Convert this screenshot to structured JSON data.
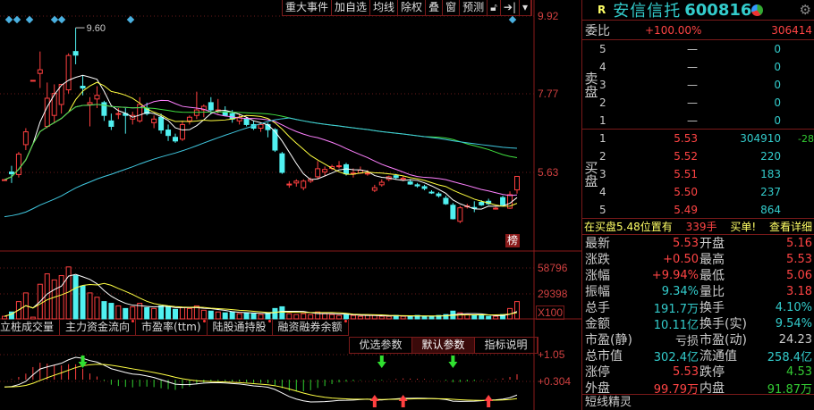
{
  "toolbar": {
    "items": [
      "重大事件",
      "加自选",
      "均线",
      "除权",
      "叠",
      "窗",
      "预测"
    ],
    "lock_icon": "lock-icon",
    "jump_icon": "jump-end-icon",
    "menu_icon": "dropdown-icon"
  },
  "axis": {
    "price_top": "9.92",
    "price_mid": "7.77",
    "price_low": "5.63",
    "vol_top": "58796",
    "vol_mid": "29398",
    "vol_unit": "X100",
    "ind_top": "+1.05",
    "ind_mid": "+0.304"
  },
  "annotations": {
    "high_label": "9.60",
    "bang_label": "榜"
  },
  "tabs": [
    {
      "label": "立桩成交量"
    },
    {
      "label": "主力资金流向"
    },
    {
      "label": "市盈率(ttm)"
    },
    {
      "label": "陆股通持股"
    },
    {
      "label": "融资融券余额"
    }
  ],
  "subtabs": [
    {
      "label": "优选参数"
    },
    {
      "label": "默认参数"
    },
    {
      "label": "指标说明"
    }
  ],
  "chart_data": {
    "type": "candlestick",
    "price_range": [
      3.5,
      9.92
    ],
    "candles": [
      [
        5.44,
        5.44,
        5.44,
        5.44
      ],
      [
        5.65,
        5.82,
        5.35,
        5.6
      ],
      [
        5.58,
        6.2,
        5.5,
        6.14
      ],
      [
        6.4,
        6.85,
        6.25,
        6.75
      ],
      [
        8.16,
        8.16,
        8.16,
        8.16
      ],
      [
        8.35,
        8.95,
        7.95,
        8.45
      ],
      [
        6.9,
        8.1,
        6.85,
        7.67
      ],
      [
        7.2,
        8.05,
        7.0,
        7.8
      ],
      [
        7.5,
        8.05,
        7.25,
        8.05
      ],
      [
        7.9,
        8.9,
        7.8,
        8.84
      ],
      [
        8.95,
        9.6,
        8.6,
        8.85
      ],
      [
        8.0,
        8.3,
        7.75,
        7.95
      ],
      [
        7.5,
        7.7,
        6.9,
        7.55
      ],
      [
        7.65,
        8.0,
        7.4,
        7.75
      ],
      [
        7.55,
        7.6,
        7.05,
        7.2
      ],
      [
        7.05,
        7.25,
        6.8,
        6.9
      ],
      [
        7.25,
        7.4,
        7.1,
        7.25
      ],
      [
        7.25,
        7.4,
        6.7,
        7.2
      ],
      [
        7.1,
        7.3,
        6.95,
        7.2
      ],
      [
        7.05,
        7.7,
        7.0,
        7.5
      ],
      [
        7.4,
        7.55,
        7.2,
        7.25
      ],
      [
        7.0,
        7.2,
        6.85,
        7.1
      ],
      [
        7.15,
        7.25,
        6.7,
        6.8
      ],
      [
        6.8,
        6.95,
        6.5,
        6.65
      ],
      [
        6.6,
        6.7,
        6.45,
        6.5
      ],
      [
        6.55,
        7.05,
        6.5,
        6.95
      ],
      [
        7.05,
        7.2,
        6.95,
        7.15
      ],
      [
        7.2,
        7.85,
        7.1,
        7.35
      ],
      [
        7.35,
        7.5,
        7.15,
        7.45
      ],
      [
        7.55,
        7.7,
        7.25,
        7.35
      ],
      [
        7.35,
        7.65,
        7.25,
        7.35
      ],
      [
        7.3,
        7.45,
        7.2,
        7.2
      ],
      [
        7.25,
        7.35,
        7.0,
        7.1
      ],
      [
        7.05,
        7.25,
        6.95,
        7.15
      ],
      [
        7.1,
        7.15,
        6.9,
        6.95
      ],
      [
        6.95,
        7.05,
        6.8,
        6.85
      ],
      [
        6.85,
        7.0,
        6.75,
        6.95
      ],
      [
        6.95,
        7.0,
        6.6,
        6.81
      ],
      [
        6.81,
        6.85,
        6.2,
        6.25
      ],
      [
        6.15,
        6.2,
        5.6,
        5.64
      ],
      [
        5.32,
        5.4,
        5.22,
        5.32
      ],
      [
        5.35,
        5.45,
        5.25,
        5.4
      ],
      [
        5.22,
        5.45,
        5.15,
        5.4
      ],
      [
        5.4,
        5.5,
        5.35,
        5.45
      ],
      [
        5.52,
        5.95,
        5.45,
        5.74
      ],
      [
        5.65,
        5.8,
        5.55,
        5.72
      ],
      [
        5.75,
        5.85,
        5.7,
        5.8
      ],
      [
        5.8,
        5.95,
        5.75,
        5.82
      ],
      [
        5.85,
        5.9,
        5.55,
        5.6
      ],
      [
        5.62,
        5.75,
        5.5,
        5.62
      ],
      [
        5.62,
        5.8,
        5.6,
        5.7
      ],
      [
        5.62,
        5.7,
        5.55,
        5.62
      ],
      [
        5.15,
        5.3,
        5.1,
        5.22
      ],
      [
        5.3,
        5.45,
        5.25,
        5.37
      ],
      [
        5.45,
        5.55,
        5.4,
        5.52
      ],
      [
        5.55,
        5.6,
        5.45,
        5.5
      ],
      [
        5.45,
        5.55,
        5.4,
        5.48
      ],
      [
        5.38,
        5.45,
        5.3,
        5.32
      ],
      [
        5.3,
        5.35,
        5.22,
        5.27
      ],
      [
        5.25,
        5.3,
        5.15,
        5.2
      ],
      [
        5.1,
        5.15,
        5.05,
        5.08
      ],
      [
        5.05,
        5.1,
        4.95,
        5.0
      ],
      [
        4.93,
        5.0,
        4.75,
        4.78
      ],
      [
        4.74,
        4.8,
        4.35,
        4.37
      ],
      [
        4.3,
        4.72,
        4.25,
        4.67
      ],
      [
        4.7,
        4.78,
        4.65,
        4.72
      ],
      [
        4.68,
        4.85,
        4.55,
        4.66
      ],
      [
        4.82,
        4.88,
        4.72,
        4.75
      ],
      [
        4.85,
        4.92,
        4.75,
        4.78
      ],
      [
        4.66,
        4.7,
        4.62,
        4.66
      ],
      [
        4.95,
        5.0,
        4.72,
        4.75
      ],
      [
        4.66,
        5.12,
        4.64,
        5.03
      ],
      [
        5.16,
        5.53,
        5.06,
        5.53
      ]
    ],
    "volumes": [
      3000,
      8000,
      20000,
      30000,
      2000,
      40000,
      52000,
      45000,
      50000,
      60000,
      50000,
      38000,
      30000,
      25000,
      20000,
      18000,
      15000,
      12000,
      14000,
      18000,
      13000,
      12000,
      15000,
      14000,
      11000,
      13000,
      12000,
      15000,
      10000,
      9000,
      8000,
      7000,
      8000,
      6000,
      7000,
      6000,
      5000,
      7000,
      12000,
      14000,
      6000,
      5000,
      6000,
      5000,
      8000,
      6000,
      5000,
      4000,
      5000,
      4000,
      3000,
      4000,
      4000,
      3000,
      3000,
      4000,
      3000,
      3000,
      4000,
      3000,
      3000,
      4000,
      5000,
      9000,
      7000,
      5000,
      4000,
      4000,
      3000,
      3000,
      5000,
      12000,
      20000
    ],
    "ma_periods": [
      5,
      10,
      20,
      60
    ],
    "ma_colors": [
      "#ffffff",
      "#ffff40",
      "#ff80ff",
      "#40e040"
    ],
    "signals": [
      {
        "index": 11,
        "type": "sell"
      },
      {
        "index": 52,
        "type": "buy"
      },
      {
        "index": 53,
        "type": "sell"
      },
      {
        "index": 56,
        "type": "buy"
      },
      {
        "index": 63,
        "type": "sell"
      },
      {
        "index": 68,
        "type": "buy"
      }
    ]
  },
  "quote": {
    "r_badge": "R",
    "name": "安信信托",
    "code": "600816",
    "webi_label": "委比",
    "webi_pct": "+100.00%",
    "webi_diff": "306414",
    "sell_label": "卖盘",
    "buy_label": "买盘",
    "sells": [
      {
        "n": "5",
        "p": "—",
        "q": "0"
      },
      {
        "n": "4",
        "p": "—",
        "q": "0"
      },
      {
        "n": "3",
        "p": "—",
        "q": "0"
      },
      {
        "n": "2",
        "p": "—",
        "q": "0"
      },
      {
        "n": "1",
        "p": "—",
        "q": "0"
      }
    ],
    "buys": [
      {
        "n": "1",
        "p": "5.53",
        "q": "304910",
        "d": "-28"
      },
      {
        "n": "2",
        "p": "5.52",
        "q": "220",
        "d": ""
      },
      {
        "n": "3",
        "p": "5.51",
        "q": "183",
        "d": ""
      },
      {
        "n": "4",
        "p": "5.50",
        "q": "237",
        "d": ""
      },
      {
        "n": "5",
        "p": "5.49",
        "q": "864",
        "d": ""
      }
    ],
    "notice": {
      "text": "在买盘5.48位置有",
      "qty": "339手",
      "tail": "买单!",
      "link": "查看详细"
    },
    "stats": [
      {
        "k": "最新",
        "v": "5.53",
        "c": "red",
        "k2": "开盘",
        "v2": "5.16",
        "c2": "red"
      },
      {
        "k": "涨跌",
        "v": "+0.50",
        "c": "red",
        "k2": "最高",
        "v2": "5.53",
        "c2": "red"
      },
      {
        "k": "涨幅",
        "v": "+9.94%",
        "c": "red",
        "k2": "最低",
        "v2": "5.06",
        "c2": "red"
      },
      {
        "k": "振幅",
        "v": "9.34%",
        "c": "cyan",
        "k2": "量比",
        "v2": "3.18",
        "c2": "red"
      },
      {
        "k": "总手",
        "v": "191.7万",
        "c": "cyan",
        "k2": "换手",
        "v2": "4.10%",
        "c2": "cyan"
      },
      {
        "k": "金额",
        "v": "10.11亿",
        "c": "cyan",
        "k2": "换手(实)",
        "v2": "9.54%",
        "c2": "cyan"
      },
      {
        "k": "市盈(静)",
        "v": "亏损",
        "c": "white",
        "k2": "市盈(动)",
        "v2": "24.23",
        "c2": "white"
      },
      {
        "k": "总市值",
        "v": "302.4亿",
        "c": "cyan",
        "k2": "流通值",
        "v2": "258.4亿",
        "c2": "cyan"
      },
      {
        "k": "涨停",
        "v": "5.53",
        "c": "red",
        "k2": "跌停",
        "v2": "4.53",
        "c2": "green"
      },
      {
        "k": "外盘",
        "v": "99.79万",
        "c": "red",
        "k2": "内盘",
        "v2": "91.87万",
        "c2": "green"
      }
    ],
    "footer": "短线精灵"
  }
}
